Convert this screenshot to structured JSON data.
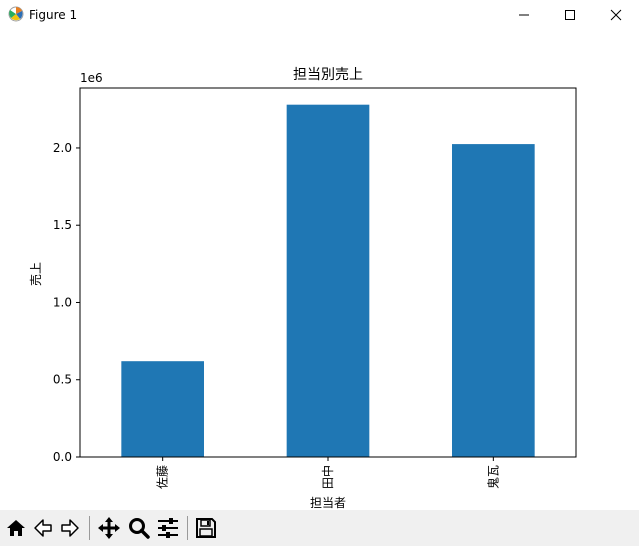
{
  "window": {
    "title": "Figure 1",
    "controls": [
      "minimize",
      "maximize",
      "close"
    ]
  },
  "chart_data": {
    "type": "bar",
    "title": "担当別売上",
    "xlabel": "担当者",
    "ylabel": "売上",
    "offset_text": "1e6",
    "categories": [
      "佐藤",
      "田中",
      "鬼瓦"
    ],
    "values": [
      620000,
      2280000,
      2025000
    ],
    "ylim": [
      0,
      2388000
    ],
    "yticks": [
      0,
      500000,
      1000000,
      1500000,
      2000000
    ],
    "ytick_labels": [
      "0.0",
      "0.5",
      "1.0",
      "1.5",
      "2.0"
    ],
    "grid": false,
    "legend": false,
    "bar_color": "#1f77b4"
  },
  "toolbar": {
    "buttons": [
      {
        "icon": "home-icon",
        "name": "home-button"
      },
      {
        "icon": "back-arrow-icon",
        "name": "back-button"
      },
      {
        "icon": "forward-arrow-icon",
        "name": "forward-button"
      },
      {
        "icon": "pan-move-icon",
        "name": "pan-button"
      },
      {
        "icon": "zoom-magnifier-icon",
        "name": "zoom-button"
      },
      {
        "icon": "configure-subplots-icon",
        "name": "configure-subplots-button"
      },
      {
        "icon": "save-disk-icon",
        "name": "save-button"
      }
    ]
  }
}
